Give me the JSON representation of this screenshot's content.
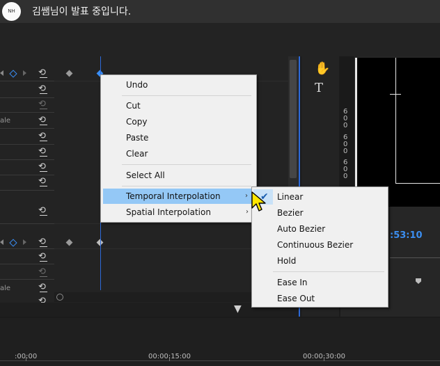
{
  "presenter": {
    "avatar_text": "NH",
    "banner": "김쌤님이 발표 중입니다."
  },
  "effect_controls": {
    "side_labels": [
      "ale",
      "ale"
    ],
    "filter_icon": "filter-icon"
  },
  "context_menu": {
    "items": [
      {
        "label": "Undo"
      },
      {
        "label": "Cut"
      },
      {
        "label": "Copy"
      },
      {
        "label": "Paste"
      },
      {
        "label": "Clear"
      },
      {
        "label": "Select All"
      },
      {
        "label": "Temporal Interpolation",
        "arrow": "›"
      },
      {
        "label": "Spatial Interpolation",
        "arrow": "›"
      }
    ]
  },
  "submenu": {
    "check": "✔",
    "items": [
      {
        "label": "Linear"
      },
      {
        "label": "Bezier"
      },
      {
        "label": "Auto Bezier"
      },
      {
        "label": "Continuous Bezier"
      },
      {
        "label": "Hold"
      },
      {
        "label": "Ease In"
      },
      {
        "label": "Ease Out"
      }
    ]
  },
  "monitor": {
    "ruler_digits": [
      "6",
      "0",
      "0",
      "6",
      "0",
      "0",
      "6",
      "0",
      "0"
    ],
    "timecode": ":53:10"
  },
  "timeline": {
    "ticks": [
      ":00:00",
      "00:00:15:00",
      "00:00:30:00"
    ]
  },
  "colors": {
    "accent": "#2d6ad9",
    "highlight": "#94c8f6",
    "timecode": "#3b8ef0"
  }
}
